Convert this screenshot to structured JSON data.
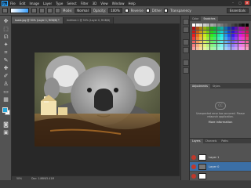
{
  "app": {
    "logo": "Ps"
  },
  "menu": [
    "File",
    "Edit",
    "Image",
    "Layer",
    "Type",
    "Select",
    "Filter",
    "3D",
    "View",
    "Window",
    "Help"
  ],
  "window_controls": [
    "–",
    "▢",
    "✕"
  ],
  "options": {
    "mode_label": "Mode:",
    "mode_value": "Normal",
    "opacity_label": "Opacity:",
    "opacity_value": "100%",
    "reverse_label": "Reverse",
    "dither_label": "Dither",
    "transparency_label": "Transparency",
    "workspace": "Essentials"
  },
  "tabs": [
    {
      "label": "koala.jpg @ 50% (Layer 1, RGB/8) *"
    },
    {
      "label": "Untitled-1 @ 50% (Layer 0, RGB/8)"
    }
  ],
  "status": {
    "zoom": "50%",
    "doc": "Doc: 1.86M/5.41M"
  },
  "panels": {
    "top_tabs": [
      "Color",
      "Swatches"
    ],
    "adj_tabs": [
      "Adjustments",
      "Styles"
    ],
    "cc_logo": "CC",
    "cc_message": "Unexpected error has occurred. Please relaunch application.",
    "more_info": "More information",
    "layers_tabs": [
      "Layers",
      "Channels",
      "Paths"
    ]
  },
  "layers": [
    {
      "name": "Layer 1"
    },
    {
      "name": "Layer 0"
    },
    {
      "name": ""
    }
  ],
  "colors": {
    "foreground": "#27a6d9",
    "background": "#ffffff",
    "selection": "#3b6fa6"
  }
}
